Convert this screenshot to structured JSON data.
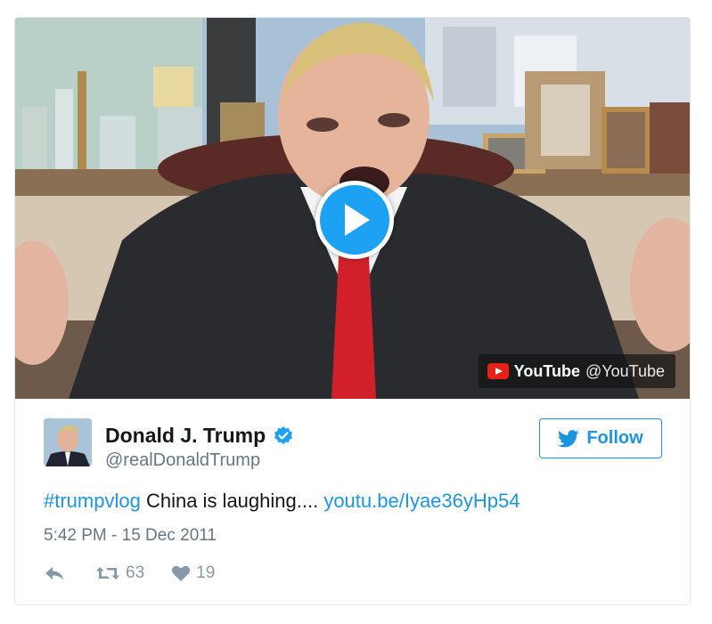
{
  "video": {
    "provider_name": "YouTube",
    "provider_handle": "@YouTube",
    "play_icon": "play-icon"
  },
  "author": {
    "name": "Donald J. Trump",
    "handle": "@realDonaldTrump",
    "verified": true
  },
  "follow_button": {
    "label": "Follow"
  },
  "tweet": {
    "hashtag": "#trumpvlog",
    "body": " China is laughing.... ",
    "link": "youtu.be/Iyae36yHp54",
    "timestamp": "5:42 PM - 15 Dec 2011"
  },
  "actions": {
    "retweets": "63",
    "likes": "19"
  },
  "colors": {
    "accent": "#1b95e0",
    "play_button": "#1da1f2",
    "text": "#14171a",
    "muted": "#657786"
  }
}
